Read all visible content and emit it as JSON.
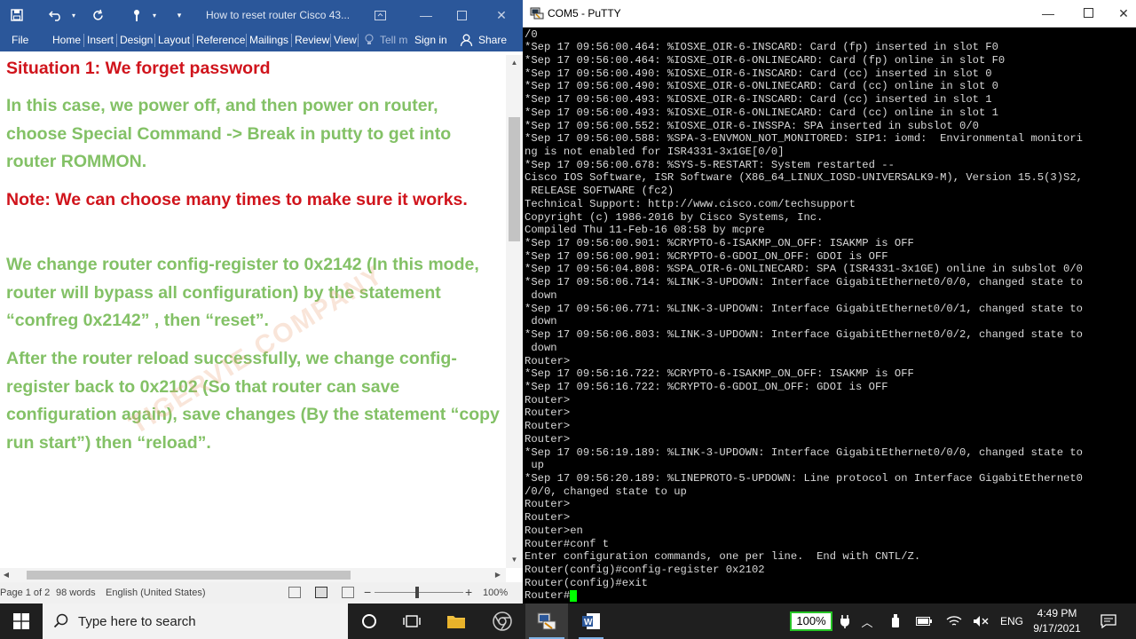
{
  "word": {
    "title": "How to reset router Cisco 43...",
    "tabs": [
      "File",
      "Home",
      "Insert",
      "Design",
      "Layout",
      "References",
      "Mailings",
      "Review",
      "View"
    ],
    "tell_me": "Tell m",
    "sign_in": "Sign in",
    "share": "Share",
    "doc_paragraphs": [
      {
        "text": "Situation 1: We forget password",
        "color": "red"
      },
      {
        "text": "In this case, we power off, and then power on router, choose Special Command -> Break in putty to get into router ROMMON.",
        "color": "green"
      },
      {
        "text": "Note: We can choose many times to make sure it works.",
        "color": "red"
      },
      {
        "text": "We change router config-register to 0x2142 (In this mode, router will bypass all configuration) by the statement “confreg 0x2142” , then “reset”.",
        "color": "green"
      },
      {
        "text": "After the router reload successfully, we change config-register back to 0x2102 (So that router can save configuration again), save changes (By the statement “copy run start”) then “reload”.",
        "color": "green"
      }
    ],
    "watermark": "TIGERVIE COMPANY",
    "status": {
      "page": "Page 1 of 2",
      "words": "98 words",
      "language": "English (United States)",
      "zoom": "100%"
    }
  },
  "putty": {
    "title": "COM5 - PuTTY",
    "lines": [
      "/0",
      "*Sep 17 09:56:00.464: %IOSXE_OIR-6-INSCARD: Card (fp) inserted in slot F0",
      "*Sep 17 09:56:00.464: %IOSXE_OIR-6-ONLINECARD: Card (fp) online in slot F0",
      "*Sep 17 09:56:00.490: %IOSXE_OIR-6-INSCARD: Card (cc) inserted in slot 0",
      "*Sep 17 09:56:00.490: %IOSXE_OIR-6-ONLINECARD: Card (cc) online in slot 0",
      "*Sep 17 09:56:00.493: %IOSXE_OIR-6-INSCARD: Card (cc) inserted in slot 1",
      "*Sep 17 09:56:00.493: %IOSXE_OIR-6-ONLINECARD: Card (cc) online in slot 1",
      "*Sep 17 09:56:00.552: %IOSXE_OIR-6-INSSPA: SPA inserted in subslot 0/0",
      "*Sep 17 09:56:00.588: %SPA-3-ENVMON_NOT_MONITORED: SIP1: iomd:  Environmental monitori",
      "ng is not enabled for ISR4331-3x1GE[0/0]",
      "*Sep 17 09:56:00.678: %SYS-5-RESTART: System restarted --",
      "Cisco IOS Software, ISR Software (X86_64_LINUX_IOSD-UNIVERSALK9-M), Version 15.5(3)S2,",
      " RELEASE SOFTWARE (fc2)",
      "Technical Support: http://www.cisco.com/techsupport",
      "Copyright (c) 1986-2016 by Cisco Systems, Inc.",
      "Compiled Thu 11-Feb-16 08:58 by mcpre",
      "*Sep 17 09:56:00.901: %CRYPTO-6-ISAKMP_ON_OFF: ISAKMP is OFF",
      "*Sep 17 09:56:00.901: %CRYPTO-6-GDOI_ON_OFF: GDOI is OFF",
      "*Sep 17 09:56:04.808: %SPA_OIR-6-ONLINECARD: SPA (ISR4331-3x1GE) online in subslot 0/0",
      "*Sep 17 09:56:06.714: %LINK-3-UPDOWN: Interface GigabitEthernet0/0/0, changed state to",
      " down",
      "*Sep 17 09:56:06.771: %LINK-3-UPDOWN: Interface GigabitEthernet0/0/1, changed state to",
      " down",
      "*Sep 17 09:56:06.803: %LINK-3-UPDOWN: Interface GigabitEthernet0/0/2, changed state to",
      " down",
      "Router>",
      "*Sep 17 09:56:16.722: %CRYPTO-6-ISAKMP_ON_OFF: ISAKMP is OFF",
      "*Sep 17 09:56:16.722: %CRYPTO-6-GDOI_ON_OFF: GDOI is OFF",
      "Router>",
      "Router>",
      "Router>",
      "Router>",
      "*Sep 17 09:56:19.189: %LINK-3-UPDOWN: Interface GigabitEthernet0/0/0, changed state to",
      " up",
      "*Sep 17 09:56:20.189: %LINEPROTO-5-UPDOWN: Line protocol on Interface GigabitEthernet0",
      "/0/0, changed state to up",
      "Router>",
      "Router>",
      "Router>en",
      "Router#conf t",
      "Enter configuration commands, one per line.  End with CNTL/Z.",
      "Router(config)#config-register 0x2102",
      "Router(config)#exit",
      "Router#"
    ]
  },
  "taskbar": {
    "search_placeholder": "Type here to search",
    "battery": "100%",
    "language": "ENG",
    "time": "4:49 PM",
    "date": "9/17/2021"
  },
  "colors": {
    "word_blue": "#2b579a",
    "doc_red": "#d0141c",
    "doc_green": "#83c166",
    "cursor_green": "#00ff00"
  }
}
